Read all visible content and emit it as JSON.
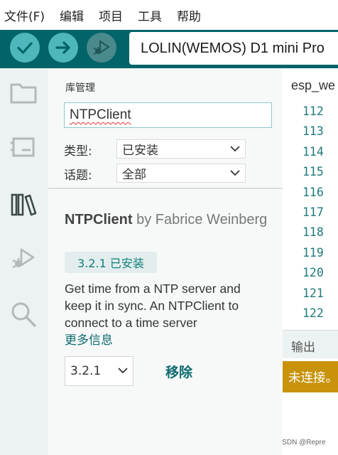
{
  "menu": {
    "items": [
      "文件(F)",
      "编辑",
      "项目",
      "工具",
      "帮助"
    ]
  },
  "toolbar": {
    "verify_icon": "check-icon",
    "upload_icon": "arrow-right-icon",
    "debug_icon": "debug-play-icon",
    "board": "LOLIN(WEMOS) D1 mini Pro",
    "accent": "#006468",
    "button_color": "#4db7bb"
  },
  "sidebar": {
    "icons": [
      "folder-icon",
      "board-icon",
      "library-icon",
      "debug-icon",
      "search-icon"
    ],
    "active": "library-icon"
  },
  "library": {
    "title": "库管理",
    "search_value": "NTPClient",
    "filters": {
      "type_label": "类型:",
      "type_value": "已安装",
      "topic_label": "话题:",
      "topic_value": "全部"
    },
    "card": {
      "name": "NTPClient",
      "author": "by Fabrice Weinberg",
      "installed_badge": "3.2.1 已安装",
      "description": "Get time from a NTP server and keep it in sync. An NTPClient to connect to a time server",
      "more_info": "更多信息",
      "version": "3.2.1",
      "remove_label": "移除"
    }
  },
  "editor": {
    "tab_name": "esp_we",
    "line_numbers": [
      "112",
      "113",
      "114",
      "115",
      "116",
      "117",
      "118",
      "119",
      "120",
      "121",
      "122"
    ],
    "output_title": "输出",
    "status": "未连接。",
    "status_color": "#c8930a"
  },
  "watermark": "CSDN @Repre"
}
